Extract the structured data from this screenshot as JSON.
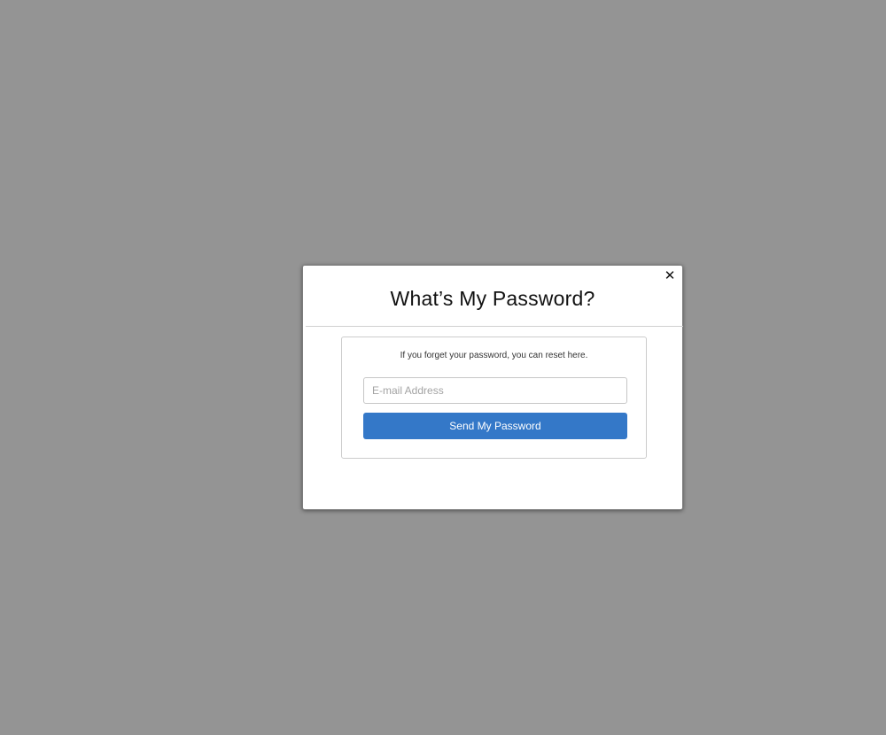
{
  "colors": {
    "backdrop": "#949494",
    "modal_background": "#ffffff",
    "accent": "#3478c8",
    "button_text": "#ffffff"
  },
  "modal": {
    "close_icon": "close-icon",
    "close_glyph": "✕",
    "title": "What’s My Password?",
    "panel": {
      "instruction": "If you forget your password, you can reset here.",
      "email_input": {
        "value": "",
        "placeholder": "E-mail Address"
      },
      "submit_label": "Send My Password"
    }
  }
}
